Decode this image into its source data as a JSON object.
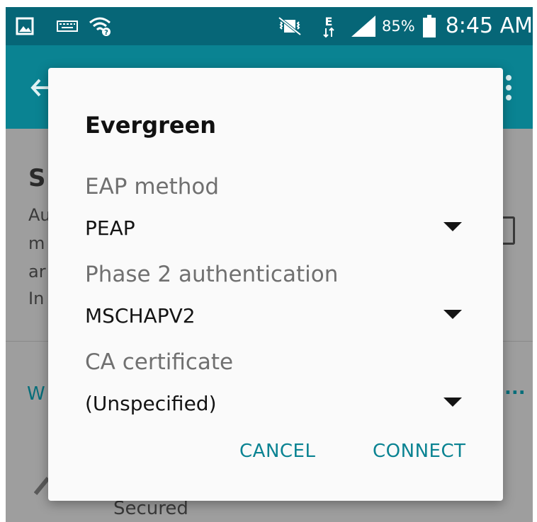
{
  "status_bar": {
    "battery_percent": "85%",
    "time": "8:45 AM",
    "icons": [
      "gallery-notification-icon",
      "keyboard-icon",
      "wifi-question-icon",
      "vibrate-mute-icon",
      "data-e-icon",
      "signal-icon",
      "battery-icon"
    ]
  },
  "toolbar": {
    "icons": [
      "back-arrow-icon",
      "overflow-menu-icon"
    ]
  },
  "background": {
    "setting_title_partial": "S",
    "setting_desc_lines": [
      "Au",
      "m",
      "ar",
      "In"
    ],
    "section_header_partial": "W",
    "more_dots": "...",
    "network_secured": "Secured"
  },
  "dialog": {
    "title": "Evergreen",
    "fields": [
      {
        "label": "EAP method",
        "value": "PEAP"
      },
      {
        "label": "Phase 2 authentication",
        "value": "MSCHAPV2"
      },
      {
        "label": "CA certificate",
        "value": "(Unspecified)"
      }
    ],
    "cancel_label": "CANCEL",
    "connect_label": "CONNECT"
  },
  "colors": {
    "accent": "#0a8392",
    "status_bar": "#066677",
    "scrim": "#9e9e9e",
    "dialog_bg": "#fafafa"
  }
}
